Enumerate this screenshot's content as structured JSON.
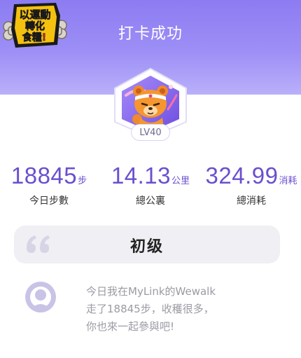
{
  "header": {
    "title": "打卡成功",
    "sticker_text": [
      "以運動",
      "轉化",
      "食糧!"
    ],
    "background_color": "#9d8ff6"
  },
  "badge": {
    "icon": "bear-mascot-icon",
    "level": "LV40"
  },
  "stats": [
    {
      "value": "18845",
      "unit": "步",
      "label": "今日步數"
    },
    {
      "value": "14.13",
      "unit": "公里",
      "label": "總公裏"
    },
    {
      "value": "324.99",
      "unit": "消耗",
      "label": "總消耗"
    }
  ],
  "level_banner": {
    "icon": "quote-icon",
    "text": "初级"
  },
  "share_message": {
    "avatar": "user-avatar-icon",
    "lines": [
      "今日我在MyLink的Wewalk",
      "走了18845步，收穫很多，",
      "你也來一起參與吧!"
    ]
  },
  "colors": {
    "accent": "#6b4fcf",
    "muted_text": "#9a9aa4",
    "banner_bg": "#efeff4"
  }
}
